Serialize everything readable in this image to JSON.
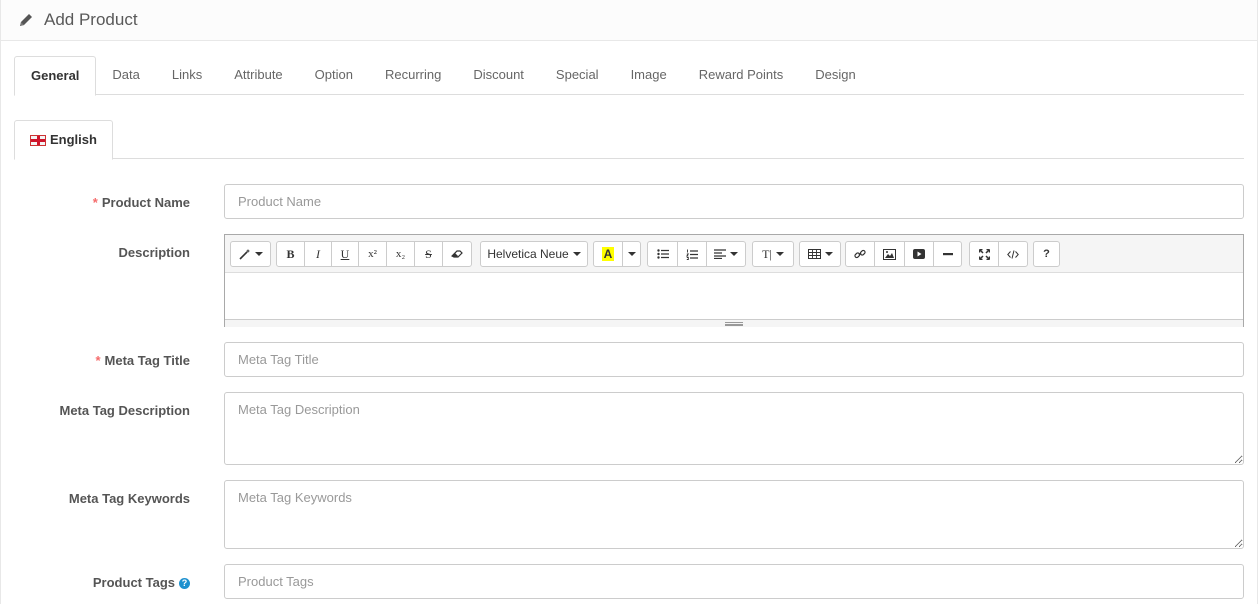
{
  "header": {
    "title": "Add Product",
    "icon": "pencil-icon"
  },
  "tabs": [
    {
      "label": "General",
      "active": true
    },
    {
      "label": "Data"
    },
    {
      "label": "Links"
    },
    {
      "label": "Attribute"
    },
    {
      "label": "Option"
    },
    {
      "label": "Recurring"
    },
    {
      "label": "Discount"
    },
    {
      "label": "Special"
    },
    {
      "label": "Image"
    },
    {
      "label": "Reward Points"
    },
    {
      "label": "Design"
    }
  ],
  "language_tab": {
    "label": "English",
    "icon": "uk-flag-icon"
  },
  "form": {
    "product_name": {
      "label": "Product Name",
      "required": true,
      "placeholder": "Product Name",
      "value": ""
    },
    "description": {
      "label": "Description",
      "value": ""
    },
    "meta_title": {
      "label": "Meta Tag Title",
      "required": true,
      "placeholder": "Meta Tag Title",
      "value": ""
    },
    "meta_description": {
      "label": "Meta Tag Description",
      "placeholder": "Meta Tag Description",
      "value": ""
    },
    "meta_keywords": {
      "label": "Meta Tag Keywords",
      "placeholder": "Meta Tag Keywords",
      "value": ""
    },
    "tags": {
      "label": "Product Tags",
      "placeholder": "Product Tags",
      "value": "",
      "help": "?"
    }
  },
  "editor_toolbar": {
    "font_name": "Helvetica Neue",
    "bold": "B",
    "italic": "I",
    "underline": "U",
    "superscript": "x²",
    "subscript": "x₂",
    "strikethrough": "S",
    "color_letter": "A",
    "fontsize": "T|",
    "help": "?"
  },
  "colors": {
    "required": "#f56b6b",
    "help_badge": "#1e91cf",
    "highlight": "#ffff00"
  }
}
